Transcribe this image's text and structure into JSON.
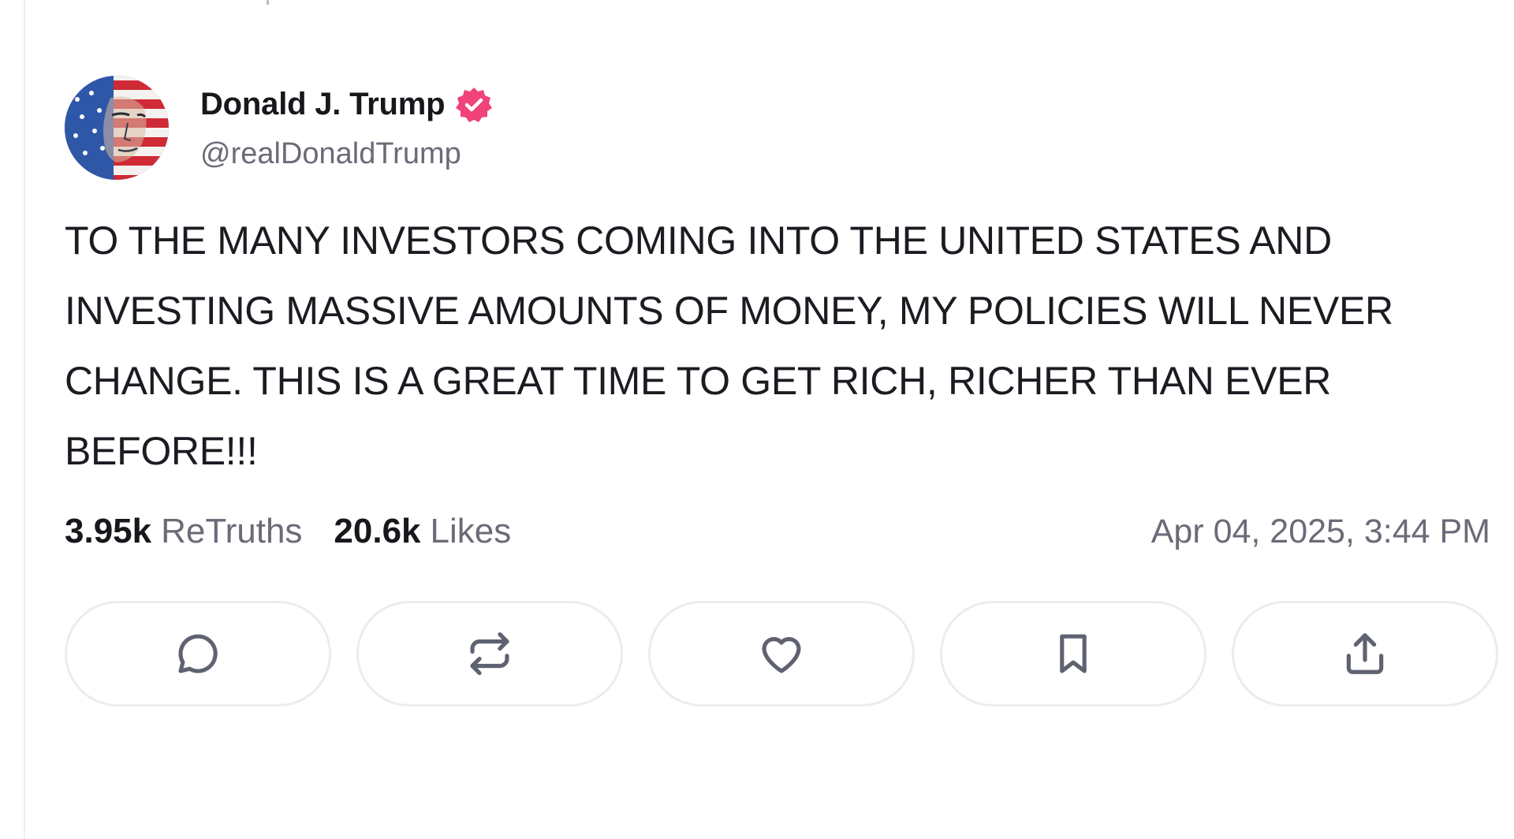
{
  "post": {
    "author": {
      "display_name": "Donald J. Trump",
      "handle": "@realDonaldTrump",
      "verified_icon": "verified-badge-icon",
      "verified_color": "#f0437a"
    },
    "text": "TO THE MANY INVESTORS COMING INTO THE UNITED STATES AND INVESTING MASSIVE AMOUNTS OF MONEY, MY POLICIES WILL NEVER CHANGE. THIS IS A GREAT TIME TO GET RICH, RICHER THAN EVER BEFORE!!!",
    "stats": {
      "retruths_count": "3.95k",
      "retruths_label": "ReTruths",
      "likes_count": "20.6k",
      "likes_label": "Likes"
    },
    "timestamp": "Apr 04, 2025, 3:44 PM",
    "actions": [
      {
        "name": "reply",
        "icon": "comment-icon"
      },
      {
        "name": "retruth",
        "icon": "retruth-icon"
      },
      {
        "name": "like",
        "icon": "heart-icon"
      },
      {
        "name": "bookmark",
        "icon": "bookmark-icon"
      },
      {
        "name": "share",
        "icon": "share-icon"
      }
    ]
  },
  "colors": {
    "text_primary": "#17171c",
    "text_secondary": "#6b6b78",
    "button_border": "#ececef",
    "icon_stroke": "#5f6270"
  }
}
